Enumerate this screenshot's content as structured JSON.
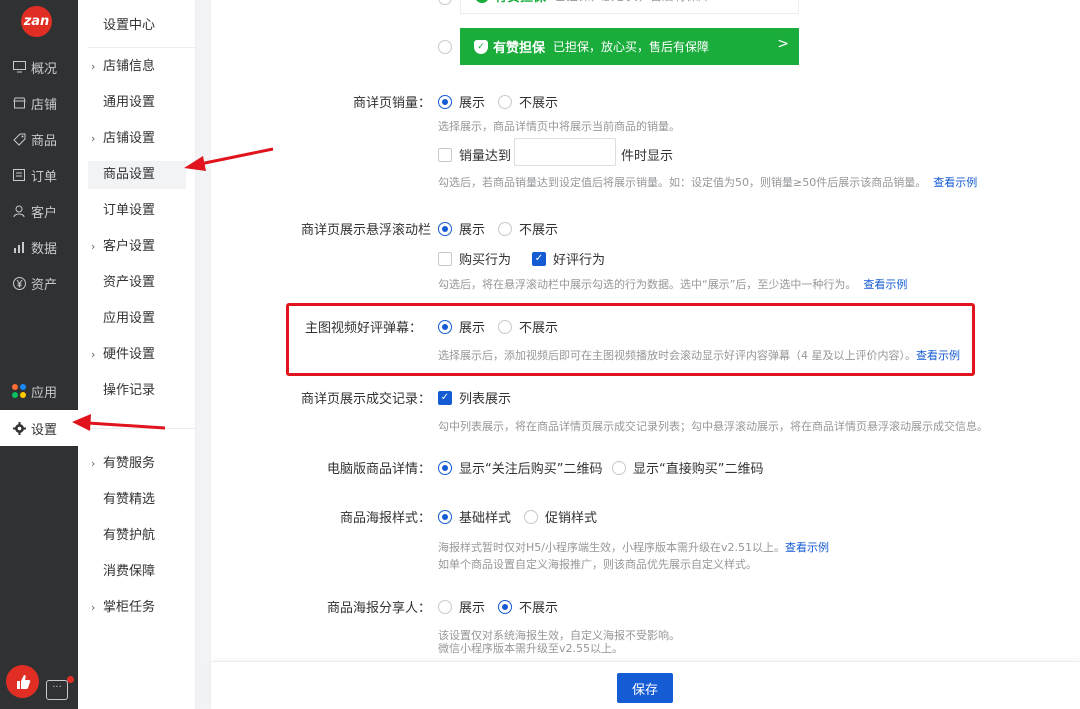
{
  "rail": {
    "logo": "zan",
    "items": [
      {
        "label": "概况",
        "icon": "monitor-icon"
      },
      {
        "label": "店铺",
        "icon": "store-icon"
      },
      {
        "label": "商品",
        "icon": "tag-icon"
      },
      {
        "label": "订单",
        "icon": "list-icon"
      },
      {
        "label": "客户",
        "icon": "user-icon"
      },
      {
        "label": "数据",
        "icon": "bar-chart-icon"
      },
      {
        "label": "资产",
        "icon": "yen-icon"
      }
    ],
    "apps": {
      "label": "应用",
      "icon": "apps-icon"
    },
    "settings": {
      "label": "设置",
      "icon": "gear-icon"
    },
    "app_colors": [
      "#ff6b35",
      "#1989fa",
      "#07c160",
      "#ffcc00"
    ]
  },
  "submenu": {
    "title": "设置中心",
    "items": [
      {
        "label": "店铺信息",
        "group": true
      },
      {
        "label": "通用设置",
        "group": false
      },
      {
        "label": "店铺设置",
        "group": true
      },
      {
        "label": "商品设置",
        "group": false,
        "active": true
      },
      {
        "label": "订单设置",
        "group": false
      },
      {
        "label": "客户设置",
        "group": true
      },
      {
        "label": "资产设置",
        "group": false
      },
      {
        "label": "应用设置",
        "group": false
      },
      {
        "label": "硬件设置",
        "group": true
      },
      {
        "label": "操作记录",
        "group": false
      }
    ],
    "items2": [
      {
        "label": "有赞服务",
        "group": true
      },
      {
        "label": "有赞精选",
        "group": false
      },
      {
        "label": "有赞护航",
        "group": false
      },
      {
        "label": "消费保障",
        "group": false
      },
      {
        "label": "掌柜任务",
        "group": true
      }
    ]
  },
  "guarantee": {
    "title": "有赞担保",
    "text": "已担保，放心买，售后有保障",
    "arrow": ">"
  },
  "sales": {
    "label": "商详页销量：",
    "options": [
      "展示",
      "不展示"
    ],
    "selected": 0,
    "hint": "选择展示，商品详情页中将展示当前商品的销量。",
    "threshold_prefix": "销量达到",
    "threshold_suffix": "件时显示",
    "threshold_checked": false,
    "threshold_hint": "勾选后，若商品销量达到设定值后将展示销量。如：设定值为50，则销量≥50件后展示该商品销量。",
    "threshold_link": "查看示例"
  },
  "scrollbar": {
    "label": "商详页展示悬浮滚动栏",
    "options": [
      "展示",
      "不展示"
    ],
    "selected": 0,
    "checks": [
      {
        "label": "购买行为",
        "checked": false
      },
      {
        "label": "好评行为",
        "checked": true
      }
    ],
    "hint": "勾选后，将在悬浮滚动栏中展示勾选的行为数据。选中“展示”后，至少选中一种行为。",
    "link": "查看示例"
  },
  "barrage": {
    "label": "主图视频好评弹幕：",
    "options": [
      "展示",
      "不展示"
    ],
    "selected": 0,
    "hint": "选择展示后，添加视频后即可在主图视频播放时会滚动显示好评内容弹幕（4 星及以上评价内容）。",
    "link": "查看示例"
  },
  "records": {
    "label": "商详页展示成交记录：",
    "option": "列表展示",
    "checked": true,
    "hint": "勾中列表展示，将在商品详情页展示成交记录列表；勾中悬浮滚动展示，将在商品详情页悬浮滚动展示成交信息。"
  },
  "pc_detail": {
    "label": "电脑版商品详情：",
    "options": [
      "显示“关注后购买”二维码",
      "显示“直接购买”二维码"
    ],
    "selected": 0
  },
  "poster": {
    "label": "商品海报样式：",
    "options": [
      "基础样式",
      "促销样式"
    ],
    "selected": 0,
    "hint1": "海报样式暂时仅对H5/小程序端生效，小程序版本需升级在v2.51以上。",
    "link": "查看示例",
    "hint2": "如单个商品设置自定义海报推广，则该商品优先展示自定义样式。"
  },
  "sharer": {
    "label": "商品海报分享人：",
    "options": [
      "展示",
      "不展示"
    ],
    "selected": 1,
    "hint1": "该设置仅对系统海报生效，自定义海报不受影响。",
    "hint2": "微信小程序版本需升级至v2.55以上。"
  },
  "footer": {
    "save_label": "保存"
  },
  "colors": {
    "accent": "#155bd4",
    "annotation": "#e1141d",
    "guarantee": "#1aad3c"
  }
}
